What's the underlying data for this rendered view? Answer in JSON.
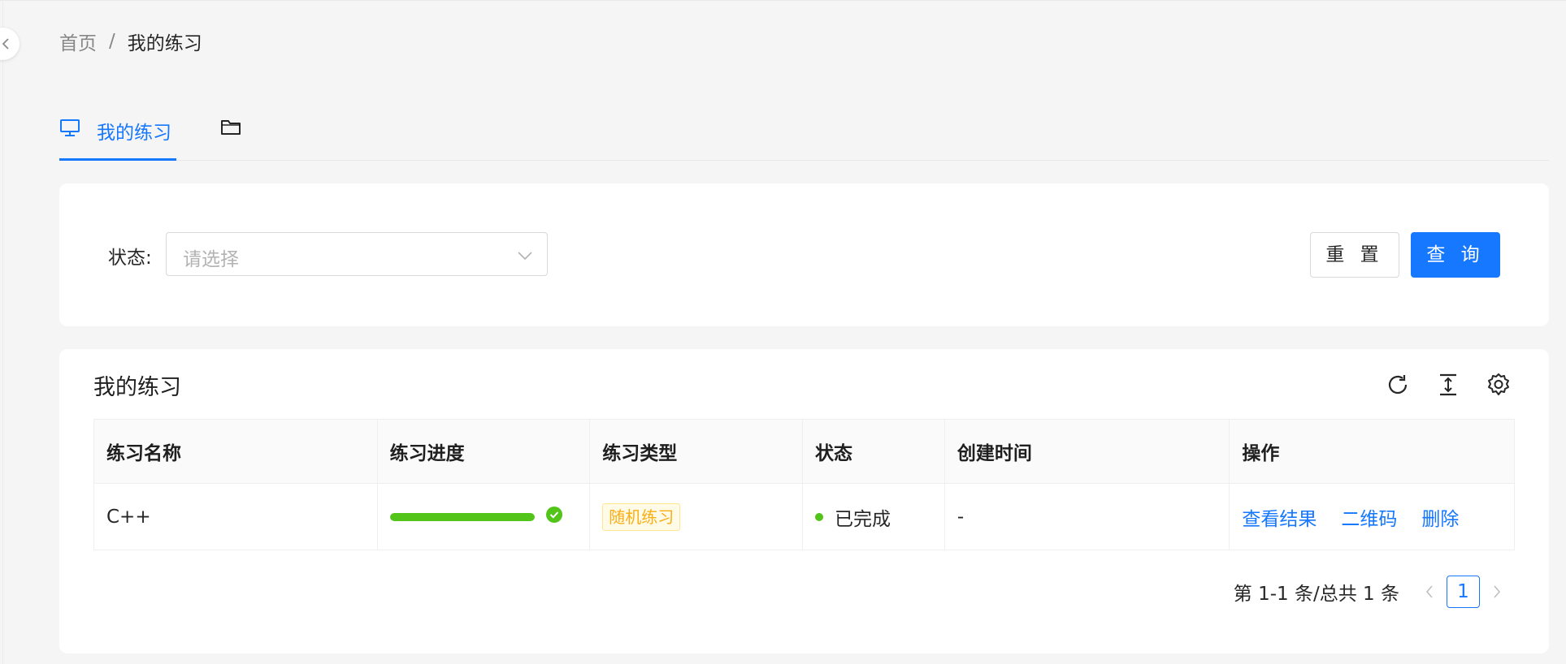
{
  "breadcrumb": {
    "home": "首页",
    "separator": "/",
    "current": "我的练习"
  },
  "tabs": [
    {
      "label": "我的练习",
      "icon": "desktop-icon",
      "active": true
    },
    {
      "label": "",
      "icon": "folder-icon",
      "active": false
    }
  ],
  "search": {
    "status_label": "状态:",
    "status_placeholder": "请选择",
    "reset_label": "重 置",
    "query_label": "查 询"
  },
  "table": {
    "title": "我的练习",
    "toolbar": [
      "reload-icon",
      "column-height-icon",
      "setting-icon"
    ],
    "columns": [
      "练习名称",
      "练习进度",
      "练习类型",
      "状态",
      "创建时间",
      "操作"
    ],
    "rows": [
      {
        "name": "C++",
        "progress": 1.0,
        "type_tag": "随机练习",
        "status": "已完成",
        "created": "-",
        "actions": [
          "查看结果",
          "二维码",
          "删除"
        ]
      }
    ]
  },
  "pagination": {
    "total_text": "第 1-1 条/总共 1 条",
    "current_page": "1"
  },
  "colors": {
    "primary": "#1677ff",
    "success": "#52c41a",
    "tag_text": "#faad14",
    "tag_bg": "#fffbe6",
    "tag_border": "#ffe58f"
  }
}
